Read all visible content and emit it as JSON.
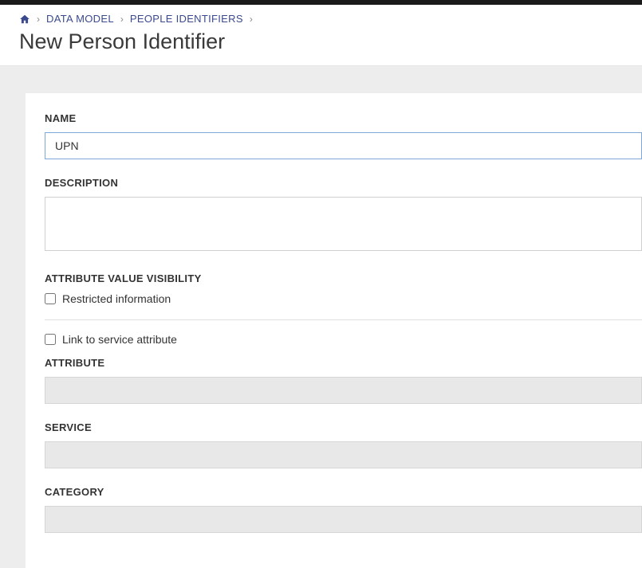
{
  "breadcrumb": {
    "data_model": "DATA MODEL",
    "people_identifiers": "PEOPLE IDENTIFIERS"
  },
  "page_title": "New Person Identifier",
  "form": {
    "name_label": "NAME",
    "name_value": "UPN",
    "description_label": "DESCRIPTION",
    "description_value": "",
    "visibility_label": "ATTRIBUTE VALUE VISIBILITY",
    "restricted_label": "Restricted information",
    "link_label": "Link to service attribute",
    "attribute_label": "ATTRIBUTE",
    "attribute_value": "",
    "service_label": "SERVICE",
    "service_value": "",
    "category_label": "CATEGORY",
    "category_value": ""
  }
}
